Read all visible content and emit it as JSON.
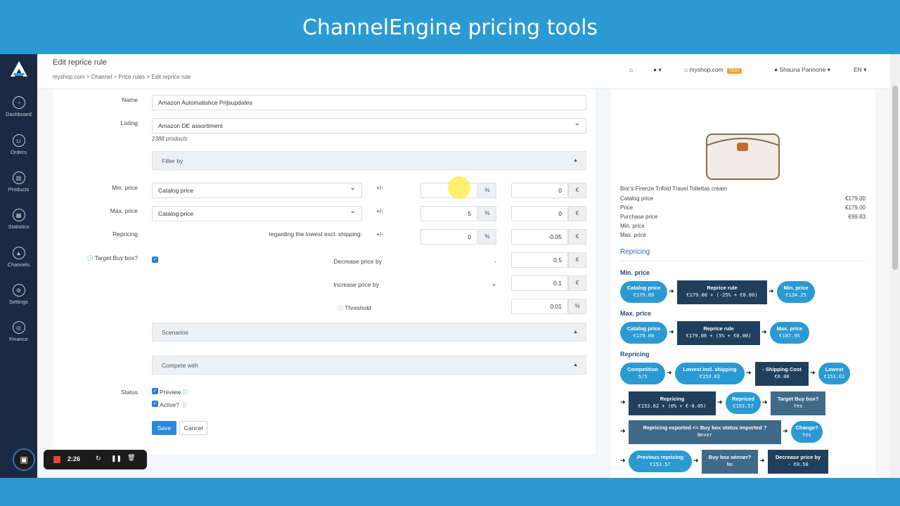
{
  "banner": {
    "title": "ChannelEngine pricing tools"
  },
  "sidebar": {
    "items": [
      {
        "label": "Dashboard",
        "icon": "dashboard-icon"
      },
      {
        "label": "Orders",
        "icon": "cart-icon"
      },
      {
        "label": "Products",
        "icon": "products-icon"
      },
      {
        "label": "Statistics",
        "icon": "statistics-icon"
      },
      {
        "label": "Channels",
        "icon": "channels-icon"
      },
      {
        "label": "Settings",
        "icon": "gear-icon"
      },
      {
        "label": "Finance",
        "icon": "finance-icon"
      }
    ]
  },
  "header": {
    "page_title": "Edit reprice rule",
    "breadcrumb": "myshop.com > Channel > Price rules > Edit reprice rule",
    "shop": "myshop.com",
    "shop_badge": "TEST",
    "user": "Shauna Pannone",
    "language": "EN"
  },
  "form": {
    "name_label": "Name",
    "name_value": "Amazon Automatishce Prijsupdates",
    "listing_label": "Listing",
    "listing_value": "Amazon DE assortiment",
    "listing_count": "2388 products",
    "filter_by": "Filter by",
    "min_price_label": "Min. price",
    "min_price_source": "Catalog price",
    "min_pct": "",
    "min_abs": "0",
    "max_price_label": "Max. price",
    "max_price_source": "Catalog price",
    "max_pct": "5",
    "max_abs": "0",
    "repricing_label": "Repricing",
    "repricing_regarding": "regarding the lowest excl. shipping:",
    "rep_pct": "0",
    "rep_abs": "-0.05",
    "plus_minus": "+/-",
    "pct_symbol": "%",
    "euro_symbol": "€",
    "target_buybox_label": "Target Buy box?",
    "decrease_label": "Decrease price by",
    "decrease_sign": "-",
    "decrease_value": "0.5",
    "increase_label": "Increase price by",
    "increase_sign": "+",
    "increase_value": "0.1",
    "threshold_label": "Threshold",
    "threshold_value": "0.01",
    "scenarios": "Scenarios",
    "compete_with": "Compete with",
    "status_label": "Status",
    "preview_label": "Preview",
    "active_label": "Active?",
    "save": "Save",
    "cancel": "Cancel"
  },
  "preview": {
    "product_name": "Bric's Firenze Trifold Travel Toilettas cream",
    "rows": [
      {
        "label": "Catalog price",
        "value": "€179.00"
      },
      {
        "label": "Price",
        "value": "€179.00"
      },
      {
        "label": "Purchase price",
        "value": "€69.83"
      },
      {
        "label": "Min. price",
        "value": ""
      },
      {
        "label": "Max. price",
        "value": ""
      }
    ],
    "repricing_heading": "Repricing",
    "min_section": "Min. price",
    "min_flow": {
      "catalog_title": "Catalog price",
      "catalog_value": "€179.00",
      "rule_title": "Reprice rule",
      "rule_value": "€179.00 + (-25% + €0.00)",
      "result_title": "Min. price",
      "result_value": "€134.25"
    },
    "max_section": "Max. price",
    "max_flow": {
      "catalog_title": "Catalog price",
      "catalog_value": "€179.00",
      "rule_title": "Reprice rule",
      "rule_value": "€179.00 + (5% + €0.00)",
      "result_title": "Max. price",
      "result_value": "€187.95"
    },
    "rep_section": "Repricing",
    "rep_flow": {
      "competition_title": "Competition",
      "competition_value": "5/5",
      "lowest_incl_title": "Lowest incl. shipping",
      "lowest_incl_value": "€153.62",
      "shipping_title": "- Shipping Cost",
      "shipping_value": "€0.00",
      "lowest_title": "Lowest",
      "lowest_value": "€153.62",
      "repricing_title": "Repricing",
      "repricing_value": "€153.62 + (0% + €-0.05)",
      "repriced_title": "Repriced",
      "repriced_value": "€153.57",
      "target_title": "Target Buy box?",
      "target_value": "Yes",
      "exported_title": "Repricing exported <= Buy box status imported ?",
      "exported_value": "Never",
      "change_title": "Change?",
      "change_value": "Yes",
      "previous_title": "Previous repricing",
      "previous_value": "€153.57",
      "winner_title": "Buy box winner?",
      "winner_value": "No",
      "decrease_title": "Decrease price by",
      "decrease_value": "- €0.50"
    }
  },
  "recorder": {
    "time": "2:26"
  },
  "colors": {
    "brand_blue": "#2b9ad3",
    "sidebar": "#1b2a44",
    "dark_box": "#1f3f5c"
  }
}
